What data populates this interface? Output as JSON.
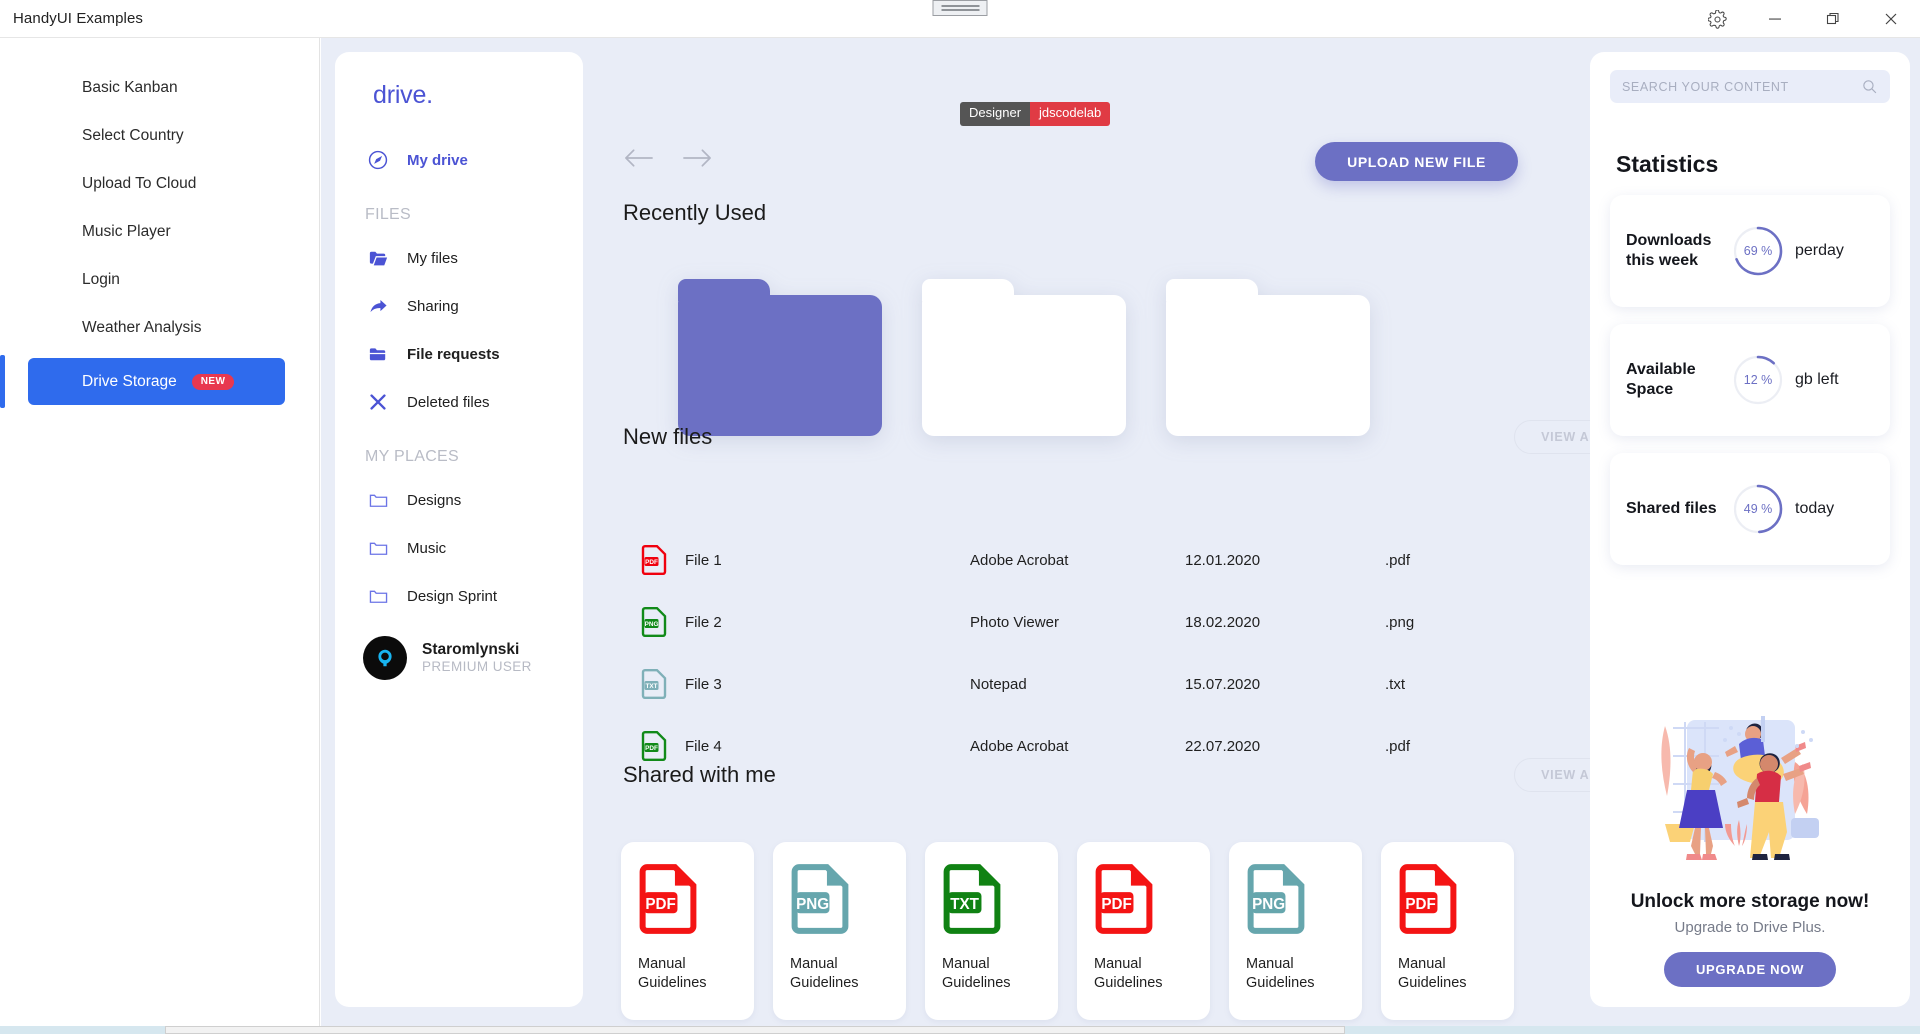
{
  "window": {
    "app_title": "HandyUI Examples",
    "controls": [
      {
        "name": "settings",
        "icon": "gear-icon"
      },
      {
        "name": "minimize",
        "icon": "minimize-icon"
      },
      {
        "name": "restore",
        "icon": "restore-icon"
      },
      {
        "name": "close",
        "icon": "close-icon"
      }
    ]
  },
  "examples_nav": {
    "items": [
      {
        "label": "Basic Kanban",
        "selected": false
      },
      {
        "label": "Select Country",
        "selected": false
      },
      {
        "label": "Upload To Cloud",
        "selected": false
      },
      {
        "label": "Music Player",
        "selected": false
      },
      {
        "label": "Login",
        "selected": false
      },
      {
        "label": "Weather Analysis",
        "selected": false
      },
      {
        "label": "Drive Storage",
        "selected": true,
        "badge": "NEW"
      }
    ]
  },
  "drive_sidebar": {
    "brand": "drive.",
    "my_drive": {
      "label": "My drive",
      "icon": "navigation-compass-icon"
    },
    "files_section": "FILES",
    "files_items": [
      {
        "label": "My files",
        "icon": "folder-open-icon",
        "bold": false
      },
      {
        "label": "Sharing",
        "icon": "share-arrow-icon",
        "bold": false
      },
      {
        "label": "File requests",
        "icon": "folder-filled-icon",
        "bold": true
      },
      {
        "label": "Deleted files",
        "icon": "x-close-icon",
        "bold": false
      }
    ],
    "places_section": "MY PLACES",
    "places_items": [
      {
        "label": "Designs",
        "icon": "folder-outline-icon"
      },
      {
        "label": "Music",
        "icon": "folder-outline-icon"
      },
      {
        "label": "Design Sprint",
        "icon": "folder-outline-icon"
      }
    ],
    "user": {
      "name": "Staromlynski",
      "role": "PREMIUM USER",
      "avatar": "avatar-icon"
    }
  },
  "main": {
    "designer_tag": {
      "left": "Designer",
      "right": "jdscodelab"
    },
    "nav_back_icon": "arrow-left-icon",
    "nav_forward_icon": "arrow-right-icon",
    "upload_button": "UPLOAD NEW FILE",
    "recently_used_title": "Recently Used",
    "folders": [
      {
        "name": "folder-1",
        "color": "#6c70c4"
      },
      {
        "name": "folder-2",
        "color": "#ffffff"
      },
      {
        "name": "folder-3",
        "color": "#ffffff"
      }
    ],
    "new_files_title": "New files",
    "view_all_label": "VIEW ALL",
    "file_rows": [
      {
        "name": "File 1",
        "app": "Adobe Acrobat",
        "date": "12.01.2020",
        "ext": ".pdf",
        "icon": "pdf-file-icon",
        "color": "#f0000e"
      },
      {
        "name": "File 2",
        "app": "Photo Viewer",
        "date": "18.02.2020",
        "ext": ".png",
        "icon": "png-file-icon",
        "color": "#118a19"
      },
      {
        "name": "File 3",
        "app": "Notepad",
        "date": "15.07.2020",
        "ext": ".txt",
        "icon": "txt-file-icon",
        "color": "#7fb0b8"
      },
      {
        "name": "File 4",
        "app": "Adobe Acrobat",
        "date": "22.07.2020",
        "ext": ".pdf",
        "icon": "pdf-file-icon",
        "color": "#118a19"
      }
    ],
    "shared_title": "Shared with me",
    "shared_view_all_label": "VIEW ALL",
    "shared_cards": [
      {
        "label": "Manual Guidelines",
        "type": "PDF",
        "icon": "pdf-file-icon",
        "color": "#f41414"
      },
      {
        "label": "Manual Guidelines",
        "type": "PNG",
        "icon": "png-file-icon",
        "color": "#66a6ad"
      },
      {
        "label": "Manual Guidelines",
        "type": "TXT",
        "icon": "txt-file-icon",
        "color": "#108213"
      },
      {
        "label": "Manual Guidelines",
        "type": "PDF",
        "icon": "pdf-file-icon",
        "color": "#f41414"
      },
      {
        "label": "Manual Guidelines",
        "type": "PNG",
        "icon": "png-file-icon",
        "color": "#66a6ad"
      },
      {
        "label": "Manual Guidelines",
        "type": "PDF",
        "icon": "pdf-file-icon",
        "color": "#f41414"
      }
    ]
  },
  "right_panel": {
    "search": {
      "placeholder": "SEARCH YOUR CONTENT",
      "value": "",
      "icon": "search-icon"
    },
    "statistics_title": "Statistics",
    "stats": [
      {
        "label": "Downloads this week",
        "percent": "69 %",
        "value": 69,
        "unit": "perday"
      },
      {
        "label": "Available Space",
        "percent": "12 %",
        "value": 12,
        "unit": "gb left"
      },
      {
        "label": "Shared files",
        "percent": "49 %",
        "value": 49,
        "unit": "today"
      }
    ],
    "promo": {
      "illustration": "people-plants-illustration",
      "headline": "Unlock more storage now!",
      "subtext": "Upgrade to Drive Plus.",
      "button": "UPGRADE NOW"
    }
  },
  "colors": {
    "accent_purple": "#6c70c4",
    "brand_blue": "#4b53d4",
    "selected_blue": "#2f6bed",
    "badge_red": "#e8384f",
    "app_bg": "#e9edf7"
  }
}
